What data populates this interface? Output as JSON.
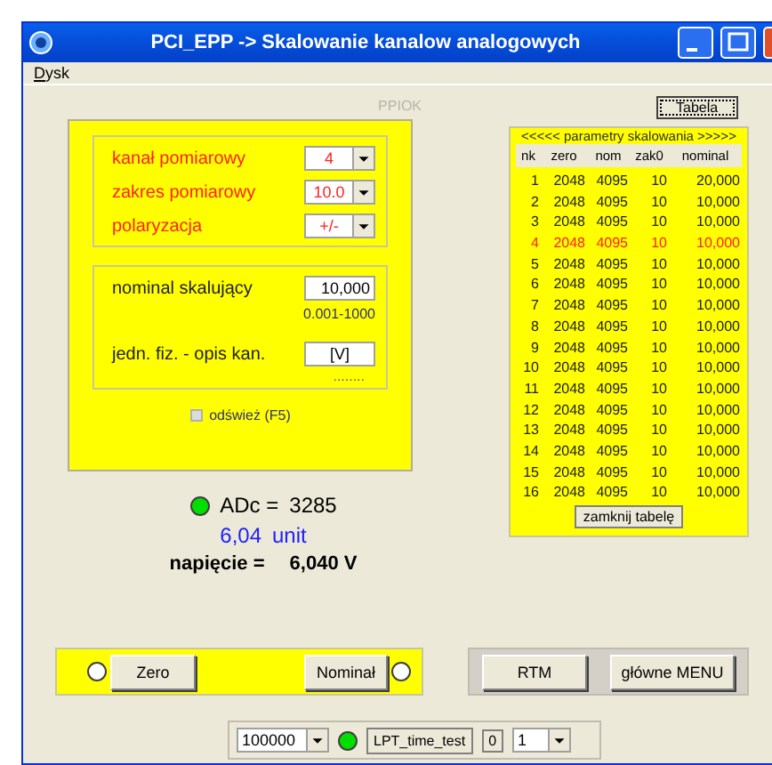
{
  "window": {
    "title": "PCI_EPP -> Skalowanie kanalow analogowych"
  },
  "menu": [
    "Dysk"
  ],
  "status_label": "PPIOK",
  "settings": {
    "combos": [
      {
        "label": "kanał pomiarowy",
        "value": "4"
      },
      {
        "label": "zakres pomiarowy",
        "value": "10.0"
      },
      {
        "label": "polaryzacja",
        "value": "+/-"
      }
    ],
    "nominal": {
      "label": "nominal skalujący",
      "value": "10,000",
      "range": "0.001-1000"
    },
    "unit": {
      "label": "jedn. fiz. - opis kan.",
      "value": "[V]",
      "dots": "........"
    },
    "refresh": {
      "label": "odśwież (F5)",
      "checked": false
    }
  },
  "readout": {
    "adc_label": "ADc  =",
    "adc_value": "3285",
    "adc_led_on": true,
    "unit_value": "6,04",
    "unit_label": "unit",
    "voltage_label": "napięcie =",
    "voltage_value": "6,040 V"
  },
  "table_button": "Tabela",
  "table": {
    "title": "<<<<< parametry skalowania >>>>>",
    "columns": [
      "nk",
      "zero",
      "nom",
      "zak0",
      "nominal"
    ],
    "rows": [
      {
        "cells": [
          "1",
          "2048",
          "4095",
          "10",
          "20,000"
        ],
        "selected": false
      },
      {
        "cells": [
          "2",
          "2048",
          "4095",
          "10",
          "10,000"
        ],
        "selected": false
      },
      {
        "cells": [
          "3",
          "2048",
          "4095",
          "10",
          "10,000"
        ],
        "selected": false
      },
      {
        "cells": [
          "4",
          "2048",
          "4095",
          "10",
          "10,000"
        ],
        "selected": true
      },
      {
        "cells": [
          "5",
          "2048",
          "4095",
          "10",
          "10,000"
        ],
        "selected": false
      },
      {
        "cells": [
          "6",
          "2048",
          "4095",
          "10",
          "10,000"
        ],
        "selected": false
      },
      {
        "cells": [
          "7",
          "2048",
          "4095",
          "10",
          "10,000"
        ],
        "selected": false
      },
      {
        "cells": [
          "8",
          "2048",
          "4095",
          "10",
          "10,000"
        ],
        "selected": false
      },
      {
        "cells": [
          "9",
          "2048",
          "4095",
          "10",
          "10,000"
        ],
        "selected": false
      },
      {
        "cells": [
          "10",
          "2048",
          "4095",
          "10",
          "10,000"
        ],
        "selected": false
      },
      {
        "cells": [
          "11",
          "2048",
          "4095",
          "10",
          "10,000"
        ],
        "selected": false
      },
      {
        "cells": [
          "12",
          "2048",
          "4095",
          "10",
          "10,000"
        ],
        "selected": false
      },
      {
        "cells": [
          "13",
          "2048",
          "4095",
          "10",
          "10,000"
        ],
        "selected": false
      },
      {
        "cells": [
          "14",
          "2048",
          "4095",
          "10",
          "10,000"
        ],
        "selected": false
      },
      {
        "cells": [
          "15",
          "2048",
          "4095",
          "10",
          "10,000"
        ],
        "selected": false
      },
      {
        "cells": [
          "16",
          "2048",
          "4095",
          "10",
          "10,000"
        ],
        "selected": false
      }
    ],
    "close_button": "zamknij tabelę"
  },
  "calibration": {
    "zero": {
      "label": "Zero",
      "selected": false
    },
    "nominal": {
      "label": "Nominał",
      "selected": false
    }
  },
  "actions": [
    "RTM",
    "główne MENU"
  ],
  "lpt": {
    "period": "100000",
    "led_on": true,
    "button": "LPT_time_test",
    "count": "0",
    "port": "1"
  }
}
